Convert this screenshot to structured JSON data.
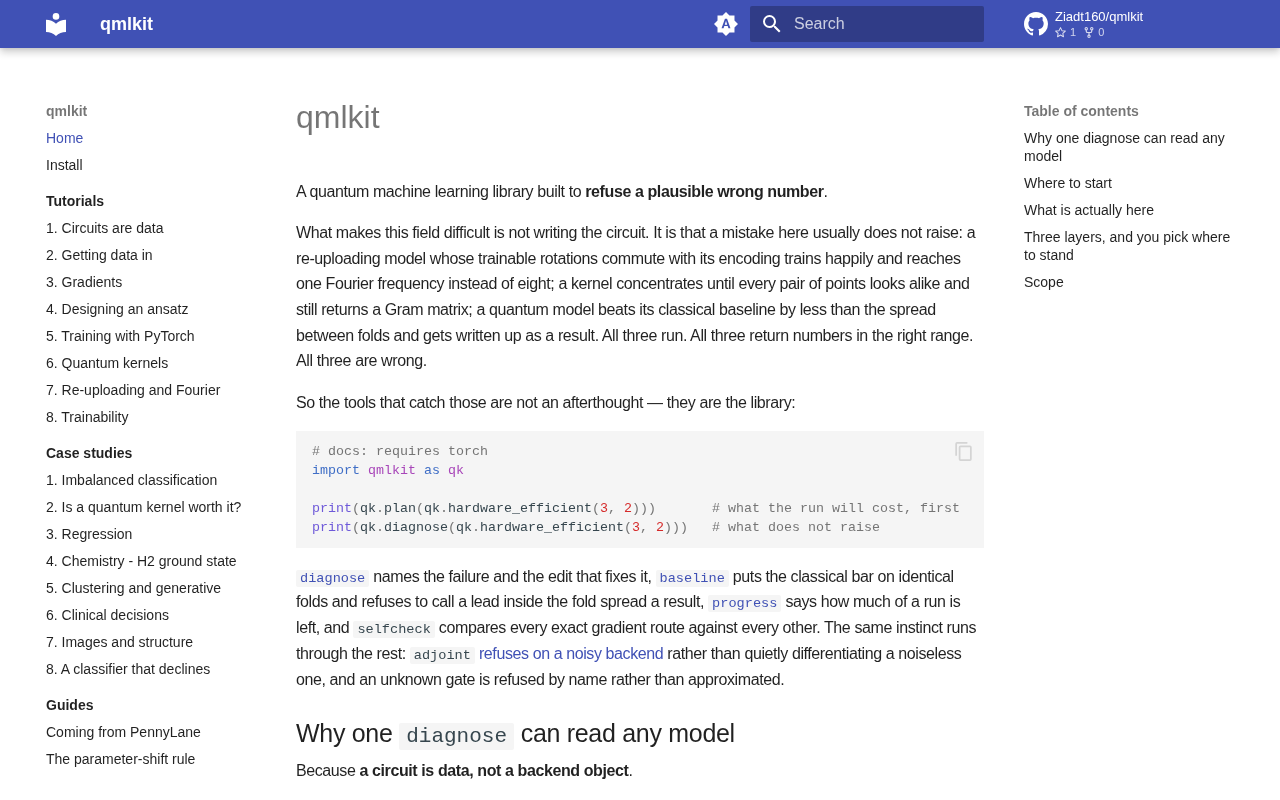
{
  "header": {
    "title": "qmlkit",
    "search": {
      "placeholder": "Search"
    },
    "repository": {
      "name": "Ziadt160/qmlkit",
      "star_count": "1",
      "fork_count": "0"
    }
  },
  "sidebar": {
    "title": "qmlkit",
    "items": [
      {
        "label": "Home",
        "selected": true
      },
      {
        "label": "Install",
        "selected": false
      }
    ],
    "sections": [
      {
        "title": "Tutorials",
        "items": [
          {
            "label": "1. Circuits are data",
            "selected": false
          },
          {
            "label": "2. Getting data in",
            "selected": false
          },
          {
            "label": "3. Gradients",
            "selected": false
          },
          {
            "label": "4. Designing an ansatz",
            "selected": false
          },
          {
            "label": "5. Training with PyTorch",
            "selected": false
          },
          {
            "label": "6. Quantum kernels",
            "selected": false
          },
          {
            "label": "7. Re-uploading and Fourier",
            "selected": false
          },
          {
            "label": "8. Trainability",
            "selected": false
          }
        ]
      },
      {
        "title": "Case studies",
        "items": [
          {
            "label": "1. Imbalanced classification",
            "selected": false
          },
          {
            "label": "2. Is a quantum kernel worth it?",
            "selected": false
          },
          {
            "label": "3. Regression",
            "selected": false
          },
          {
            "label": "4. Chemistry - H2 ground state",
            "selected": false
          },
          {
            "label": "5. Clustering and generative",
            "selected": false
          },
          {
            "label": "6. Clinical decisions",
            "selected": false
          },
          {
            "label": "7. Images and structure",
            "selected": false
          },
          {
            "label": "8. A classifier that declines",
            "selected": false
          }
        ]
      },
      {
        "title": "Guides",
        "items": [
          {
            "label": "Coming from PennyLane",
            "selected": false
          },
          {
            "label": "The parameter-shift rule",
            "selected": false
          }
        ]
      }
    ]
  },
  "content": {
    "title": "qmlkit",
    "blocks": [
      {
        "kind": "paragraph",
        "segments": [
          {
            "kind": "text",
            "text": "A quantum machine learning library built to **refuse a plausible wrong number**."
          }
        ]
      },
      {
        "kind": "paragraph",
        "segments": [
          {
            "kind": "text",
            "text": "What makes this field difficult is not writing the circuit. It is that a mistake here usually does not raise: a re-uploading model whose trainable rotations commute with its encoding trains happily and reaches one Fourier frequency instead of eight; a kernel concentrates until every pair of points looks alike and still returns a Gram matrix; a quantum model beats its classical baseline by less than the spread between folds and gets written up as a result. All three run. All three return numbers in the right range. All three are wrong."
          }
        ]
      },
      {
        "kind": "paragraph",
        "segments": [
          {
            "kind": "text",
            "text": "So the tools that catch those are not an afterthought — they are the library:"
          }
        ]
      },
      {
        "kind": "code",
        "groups": [
          [
            [
              {
                "kind": "comment",
                "text": "# docs: requires torch"
              }
            ],
            [
              {
                "kind": "keyword",
                "text": "import "
              },
              {
                "kind": "namespace",
                "text": "qmlkit "
              },
              {
                "kind": "keyword",
                "text": "as "
              },
              {
                "kind": "namespace",
                "text": "qk"
              }
            ]
          ],
          [
            [
              {
                "kind": "builtin",
                "text": "print"
              },
              {
                "kind": "punctuation",
                "text": "("
              },
              {
                "kind": "name",
                "text": "qk"
              },
              {
                "kind": "punctuation",
                "text": "."
              },
              {
                "kind": "name",
                "text": "plan"
              },
              {
                "kind": "punctuation",
                "text": "("
              },
              {
                "kind": "name",
                "text": "qk"
              },
              {
                "kind": "punctuation",
                "text": "."
              },
              {
                "kind": "name",
                "text": "hardware_efficient"
              },
              {
                "kind": "punctuation",
                "text": "("
              },
              {
                "kind": "number",
                "text": "3"
              },
              {
                "kind": "punctuation",
                "text": ", "
              },
              {
                "kind": "number",
                "text": "2"
              },
              {
                "kind": "punctuation",
                "text": ")))       "
              },
              {
                "kind": "comment",
                "text": "# what the run will cost, first"
              }
            ],
            [
              {
                "kind": "builtin",
                "text": "print"
              },
              {
                "kind": "punctuation",
                "text": "("
              },
              {
                "kind": "name",
                "text": "qk"
              },
              {
                "kind": "punctuation",
                "text": "."
              },
              {
                "kind": "name",
                "text": "diagnose"
              },
              {
                "kind": "punctuation",
                "text": "("
              },
              {
                "kind": "name",
                "text": "qk"
              },
              {
                "kind": "punctuation",
                "text": "."
              },
              {
                "kind": "name",
                "text": "hardware_efficient"
              },
              {
                "kind": "punctuation",
                "text": "("
              },
              {
                "kind": "number",
                "text": "3"
              },
              {
                "kind": "punctuation",
                "text": ", "
              },
              {
                "kind": "number",
                "text": "2"
              },
              {
                "kind": "punctuation",
                "text": ")))   "
              },
              {
                "kind": "comment",
                "text": "# what does not raise"
              }
            ]
          ]
        ]
      },
      {
        "kind": "paragraph",
        "segments": [
          {
            "kind": "code_link",
            "text": "diagnose"
          },
          {
            "kind": "text",
            "text": " names the failure and the edit that fixes it, "
          },
          {
            "kind": "code_link",
            "text": "baseline"
          },
          {
            "kind": "text",
            "text": " puts the classical bar on identical folds and refuses to call a lead inside the fold spread a result, "
          },
          {
            "kind": "code_link",
            "text": "progress"
          },
          {
            "kind": "text",
            "text": " says how much of a run is left, and "
          },
          {
            "kind": "code",
            "text": "selfcheck"
          },
          {
            "kind": "text",
            "text": " compares every exact gradient route against every other. The same instinct runs through the rest: "
          },
          {
            "kind": "code",
            "text": "adjoint"
          },
          {
            "kind": "link",
            "text": "refuses on a noisy backend"
          },
          {
            "kind": "text",
            "text": " rather than quietly differentiating a noiseless one, and an unknown gate is refused by name rather than approximated."
          }
        ]
      },
      {
        "kind": "heading",
        "segments": [
          {
            "kind": "text",
            "text": "Why one "
          },
          {
            "kind": "code",
            "text": "diagnose"
          },
          {
            "kind": "text",
            "text": " can read any model"
          }
        ]
      },
      {
        "kind": "paragraph",
        "segments": [
          {
            "kind": "text",
            "text": "Because **a circuit is data, not a backend object**."
          }
        ]
      }
    ]
  },
  "toc": {
    "title": "Table of contents",
    "items": [
      "Why one diagnose can read any model",
      "Where to start",
      "What is actually here",
      "Three layers, and you pick where to stand",
      "Scope"
    ]
  }
}
